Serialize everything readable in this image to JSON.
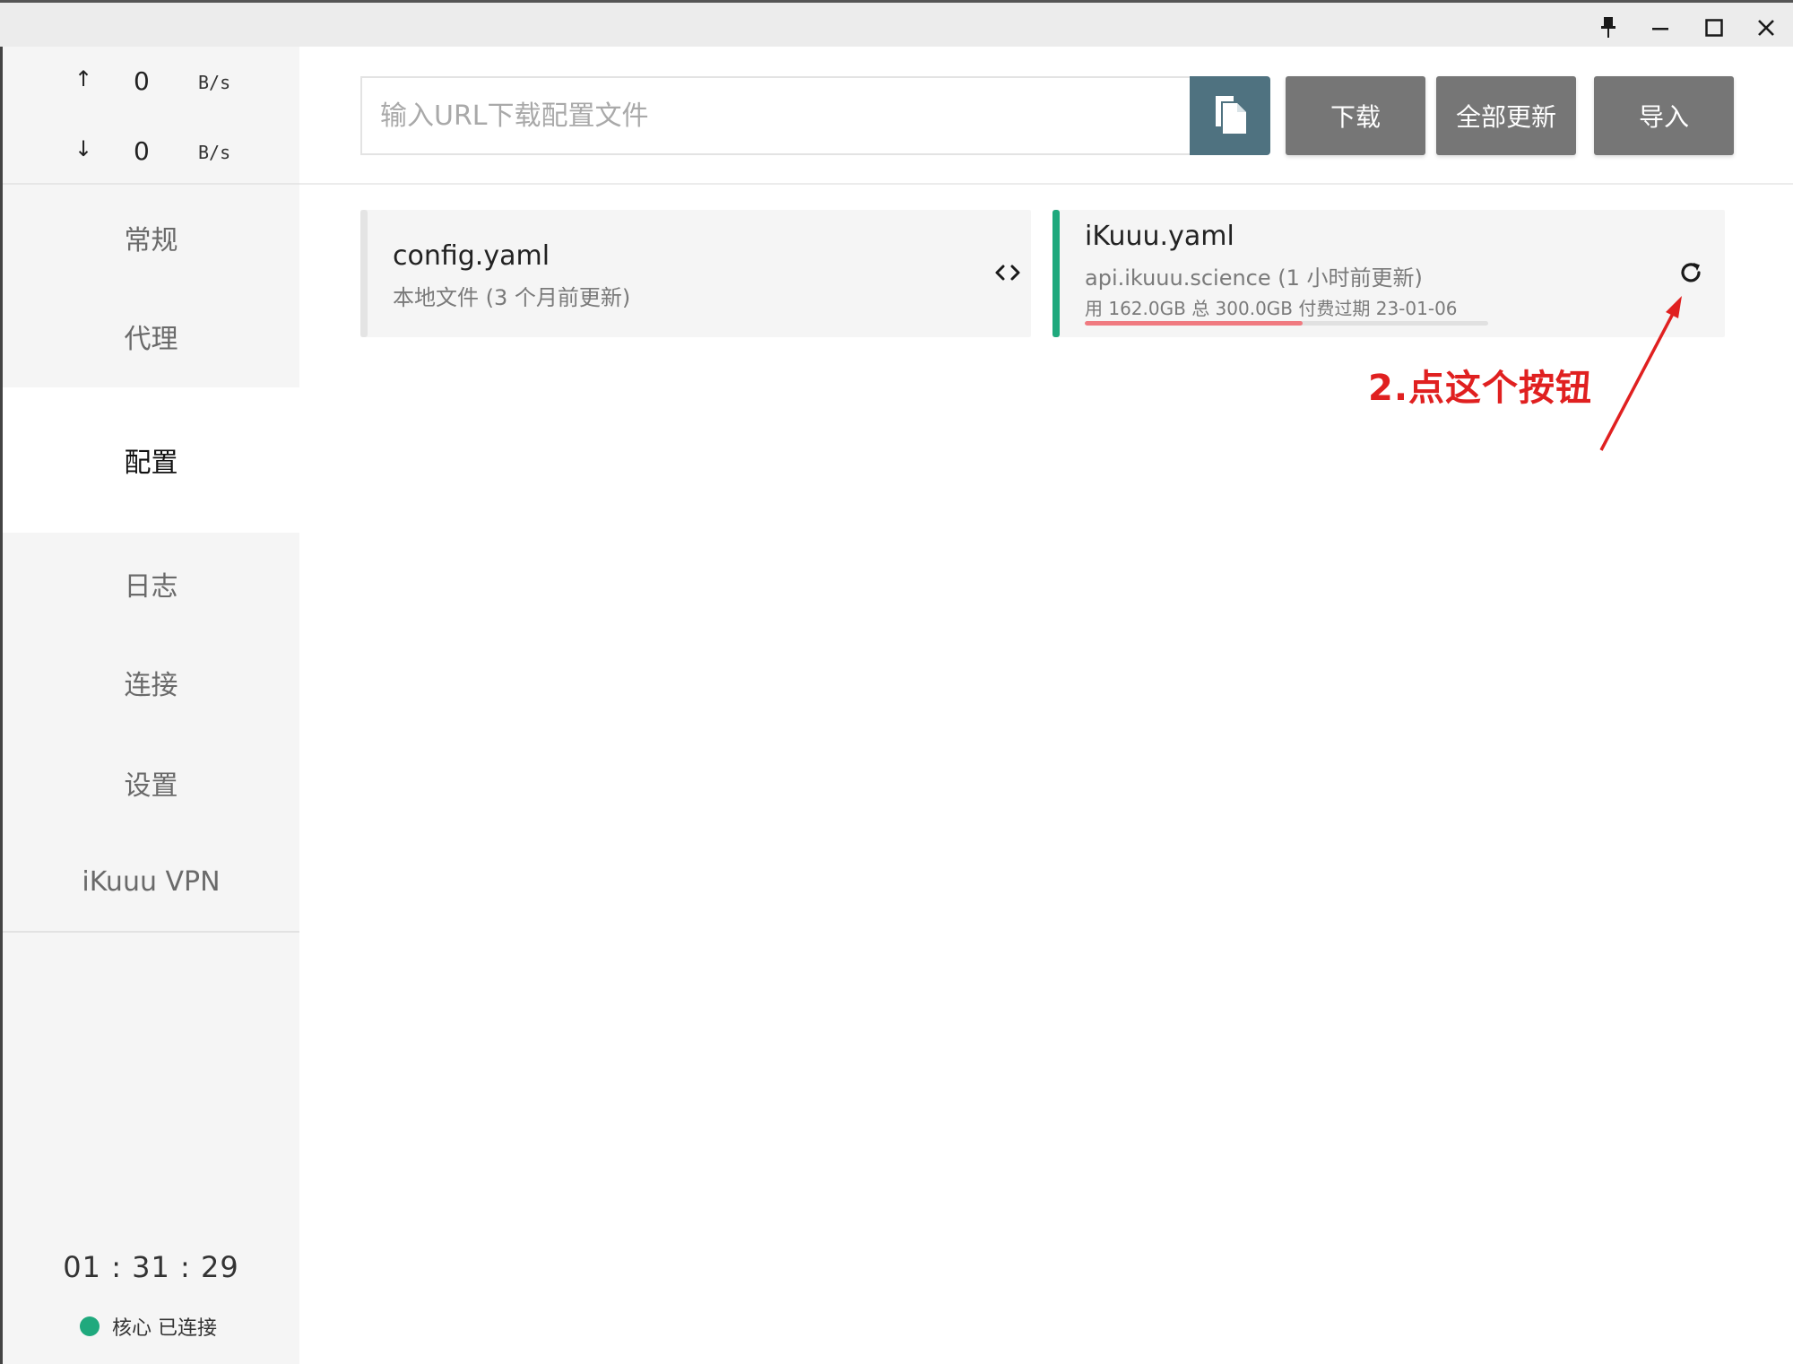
{
  "window": {
    "pin_icon": "pin-icon",
    "minimize_icon": "minimize-icon",
    "maximize_icon": "maximize-icon",
    "close_icon": "close-icon"
  },
  "sidebar": {
    "upload": {
      "arrow": "↑",
      "value": "0",
      "unit": "B/s"
    },
    "download": {
      "arrow": "↓",
      "value": "0",
      "unit": "B/s"
    },
    "items": [
      {
        "label": "常规",
        "active": false
      },
      {
        "label": "代理",
        "active": false
      },
      {
        "label": "配置",
        "active": true
      },
      {
        "label": "日志",
        "active": false
      },
      {
        "label": "连接",
        "active": false
      },
      {
        "label": "设置",
        "active": false
      },
      {
        "label": "iKuuu VPN",
        "active": false
      }
    ],
    "timer": "01 : 31 : 29",
    "core_status": "核心 已连接",
    "status_color": "#1fa97d"
  },
  "toolbar": {
    "url_placeholder": "输入URL下载配置文件",
    "url_value": "",
    "paste_icon": "paste-icon",
    "download_label": "下载",
    "update_all_label": "全部更新",
    "import_label": "导入"
  },
  "profiles": [
    {
      "name": "config.yaml",
      "subtitle": "本地文件 (3 个月前更新)",
      "action_icon": "code-icon",
      "selected": false
    },
    {
      "name": "iKuuu.yaml",
      "subtitle": "api.ikuuu.science (1 小时前更新)",
      "usage": "用 162.0GB   总 300.0GB   付费过期 23-01-06",
      "used_fraction": 0.54,
      "action_icon": "refresh-icon",
      "selected": true
    }
  ],
  "annotation": {
    "text": "2.点这个按钮",
    "color": "#e02020"
  },
  "colors": {
    "accent": "#1fa97d",
    "paste_button": "#4f7280",
    "action_button": "#767676",
    "usage_bar": "#f07a80"
  }
}
